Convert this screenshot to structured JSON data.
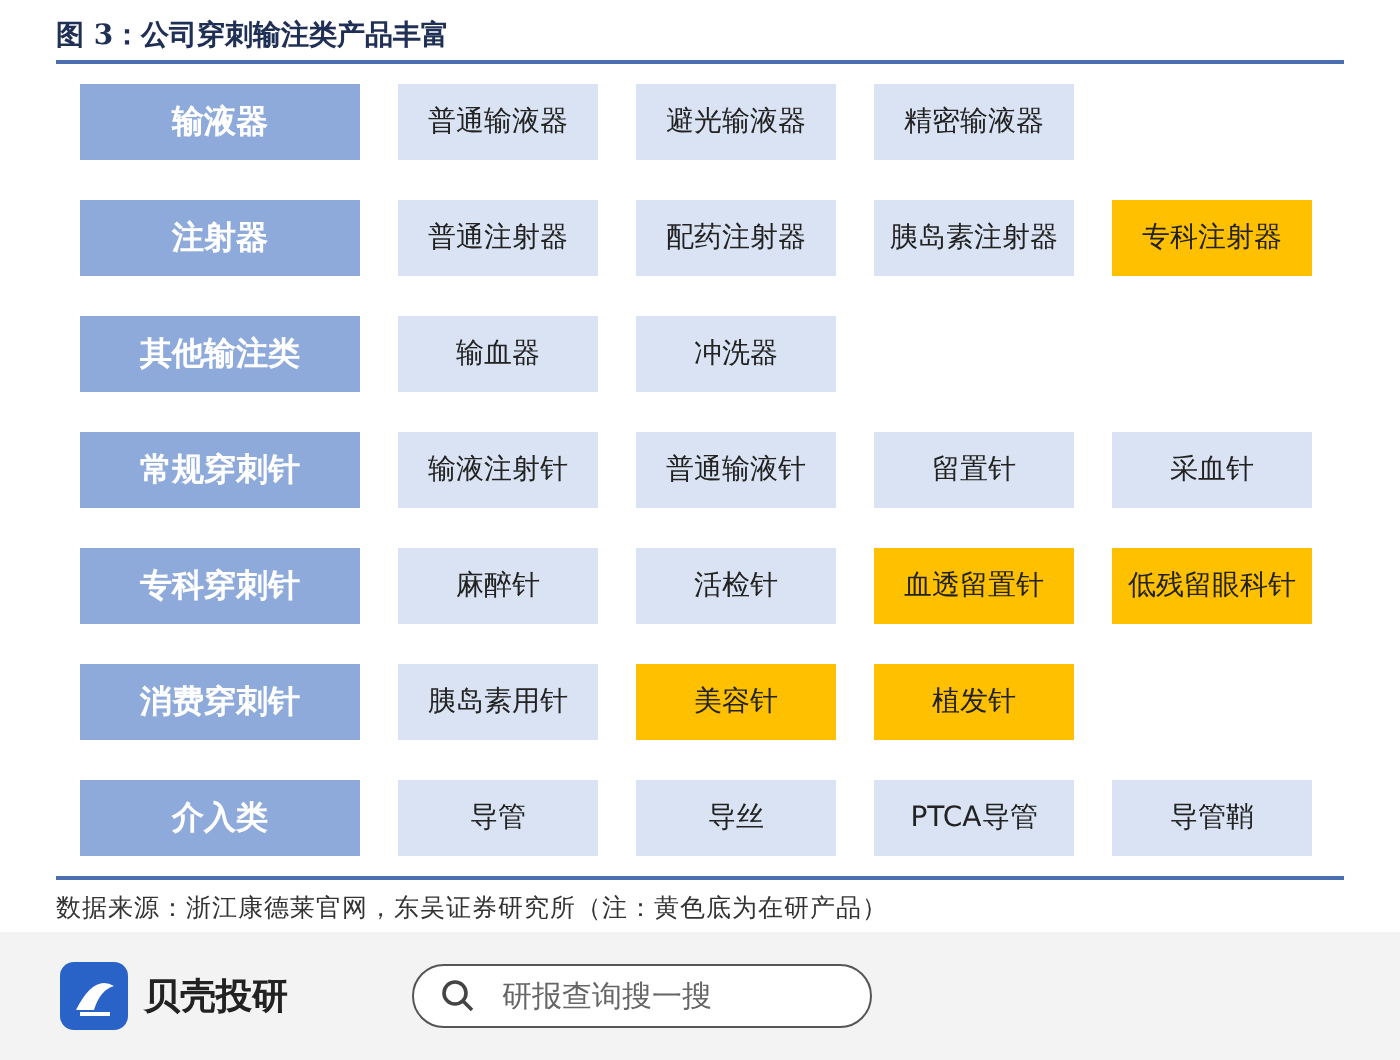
{
  "figure": {
    "title": "图 3：公司穿刺输注类产品丰富",
    "rows": [
      {
        "category": "输液器",
        "products": [
          {
            "name": "普通输液器",
            "in_development": false
          },
          {
            "name": "避光输液器",
            "in_development": false
          },
          {
            "name": "精密输液器",
            "in_development": false
          }
        ]
      },
      {
        "category": "注射器",
        "products": [
          {
            "name": "普通注射器",
            "in_development": false
          },
          {
            "name": "配药注射器",
            "in_development": false
          },
          {
            "name": "胰岛素注射器",
            "in_development": false
          },
          {
            "name": "专科注射器",
            "in_development": true
          }
        ]
      },
      {
        "category": "其他输注类",
        "products": [
          {
            "name": "输血器",
            "in_development": false
          },
          {
            "name": "冲洗器",
            "in_development": false
          }
        ]
      },
      {
        "category": "常规穿刺针",
        "products": [
          {
            "name": "输液注射针",
            "in_development": false
          },
          {
            "name": "普通输液针",
            "in_development": false
          },
          {
            "name": "留置针",
            "in_development": false
          },
          {
            "name": "采血针",
            "in_development": false
          }
        ]
      },
      {
        "category": "专科穿刺针",
        "products": [
          {
            "name": "麻醉针",
            "in_development": false
          },
          {
            "name": "活检针",
            "in_development": false
          },
          {
            "name": "血透留置针",
            "in_development": true
          },
          {
            "name": "低残留眼科针",
            "in_development": true
          }
        ]
      },
      {
        "category": "消费穿刺针",
        "products": [
          {
            "name": "胰岛素用针",
            "in_development": false
          },
          {
            "name": "美容针",
            "in_development": true
          },
          {
            "name": "植发针",
            "in_development": true
          }
        ]
      },
      {
        "category": "介入类",
        "products": [
          {
            "name": "导管",
            "in_development": false
          },
          {
            "name": "导丝",
            "in_development": false
          },
          {
            "name": "PTCA导管",
            "in_development": false
          },
          {
            "name": "导管鞘",
            "in_development": false
          }
        ]
      }
    ],
    "source": "数据来源：浙江康德莱官网，东吴证券研究所（注：黄色底为在研产品）"
  },
  "app_bar": {
    "brand": "贝壳投研",
    "search": {
      "placeholder": "研报查询搜一搜"
    }
  }
}
